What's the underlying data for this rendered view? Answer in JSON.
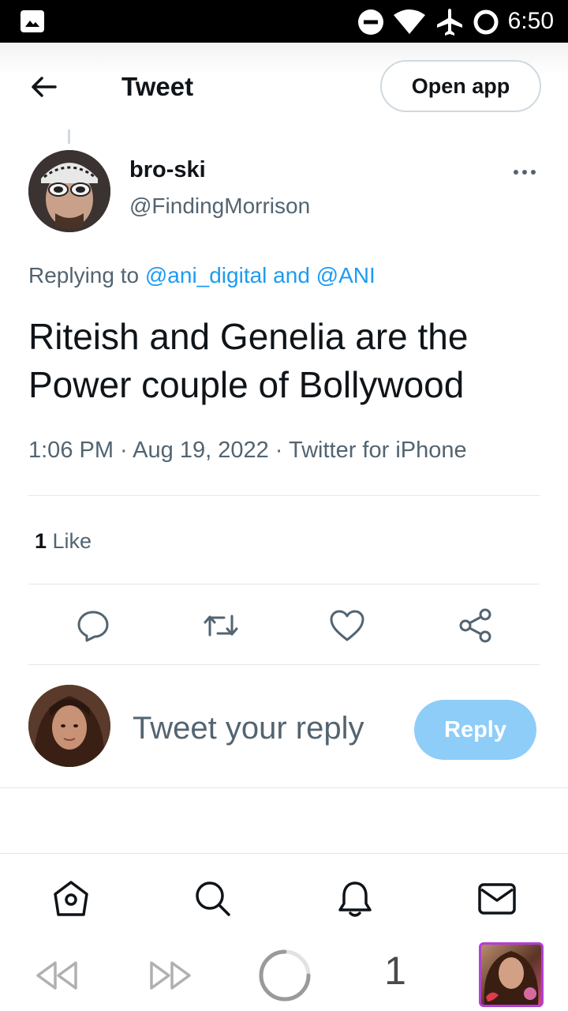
{
  "status_bar": {
    "time": "6:50",
    "icons": [
      "gallery-icon",
      "do-not-disturb-icon",
      "wifi-icon",
      "airplane-icon",
      "loading-ring-icon"
    ]
  },
  "header": {
    "title": "Tweet",
    "open_app_label": "Open app",
    "back_icon": "arrow-left-icon"
  },
  "tweet": {
    "author": {
      "name": "bro-ski",
      "handle": "@FindingMorrison"
    },
    "replying_prefix": "Replying to ",
    "replying_to": "@ani_digital and @ANI",
    "text": "Riteish and Genelia are the Power couple of Bollywood",
    "meta": "1:06 PM · Aug 19, 2022 · Twitter for iPhone",
    "likes_count": "1",
    "likes_label": " Like",
    "actions": [
      "reply-icon",
      "retweet-icon",
      "like-icon",
      "share-icon"
    ]
  },
  "composer": {
    "placeholder": "Tweet your reply",
    "reply_label": "Reply"
  },
  "bottom_nav": [
    "home-icon",
    "search-icon",
    "notifications-icon",
    "messages-icon"
  ],
  "browser_bar": {
    "tab_count": "1",
    "icons": [
      "rewind-icon",
      "fast-forward-icon",
      "loading-icon",
      "profile-thumbnail"
    ]
  },
  "colors": {
    "accent": "#1d9bf0",
    "reply_button": "#8ecdf8",
    "secondary_text": "#536471",
    "divider": "#e1e8ed"
  }
}
